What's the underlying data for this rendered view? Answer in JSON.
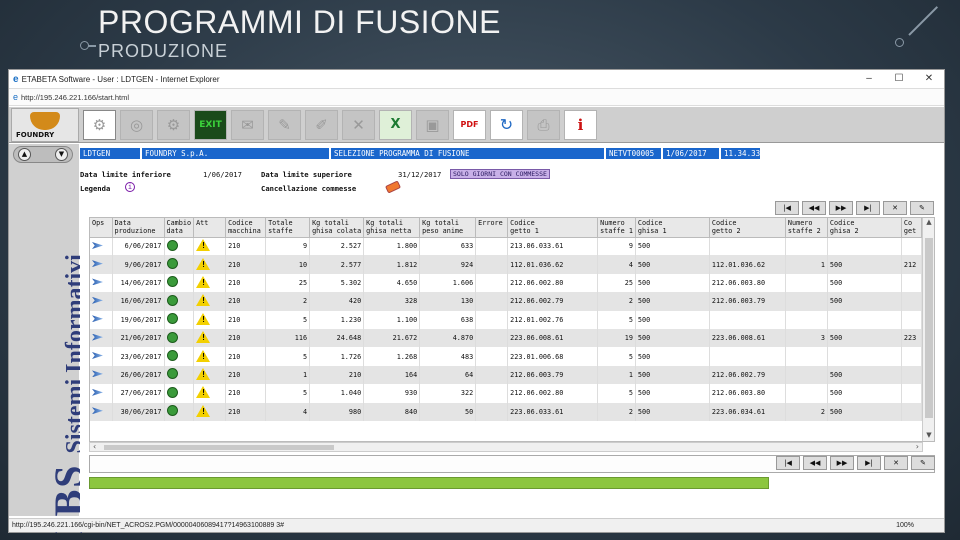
{
  "slide": {
    "title": "PROGRAMMI DI FUSIONE",
    "subtitle": "PRODUZIONE"
  },
  "window": {
    "title": "ETABETA Software - User : LDTGEN - Internet Explorer",
    "address": "http://195.246.221.166/start.html",
    "controls": [
      "–",
      "☐",
      "✕"
    ],
    "status_url": "http://195.246.221.166/cgi-bin/NET_ACROS2.PGM/00000406089417?14963100889 3#",
    "zoom": "100%"
  },
  "toolbar": {
    "logo_text": "FOUNDRY",
    "buttons": [
      "tool-1",
      "disc",
      "gear",
      "exit",
      "export",
      "edit",
      "tool-7",
      "cancel",
      "excel",
      "box",
      "pdf",
      "refresh",
      "print",
      "info"
    ],
    "exit_label": "EXIT",
    "pdf_label": "PDF",
    "excel_label": "X",
    "info_label": "i"
  },
  "sidebar": {
    "brand_big": "IBS",
    "brand_small": "Sistemi Informativi",
    "prev_arrow": "▲",
    "next_arrow": "▼"
  },
  "info_bar": {
    "user": "LDTGEN",
    "company": "FOUNDRY S.p.A.",
    "screen": "SELEZIONE PROGRAMMA DI FUSIONE",
    "terminal": "NETVT00005",
    "date": "1/06/2017",
    "time": "11.34.33"
  },
  "filters": {
    "lower_label": "Data limite inferiore",
    "lower_value": "1/06/2017",
    "upper_label": "Data limite superiore",
    "upper_value": "31/12/2017",
    "only_orders_button": "SOLO GIORNI CON COMMESSE",
    "legend_label": "Legenda",
    "legend_icon": "i",
    "cancel_orders_label": "Cancellazione commesse"
  },
  "pager": [
    "|◀",
    "◀◀",
    "▶▶",
    "▶|",
    "✕",
    "✎"
  ],
  "grid": {
    "headers": [
      [
        "Ops",
        ""
      ],
      [
        "Data",
        "produzione"
      ],
      [
        "Cambio",
        "data"
      ],
      [
        "Att",
        ""
      ],
      [
        "Codice",
        "macchina"
      ],
      [
        "Totale",
        "staffe"
      ],
      [
        "Kg totali",
        "ghisa colata"
      ],
      [
        "Kg totali",
        "ghisa netta"
      ],
      [
        "Kg totali",
        "peso anime"
      ],
      [
        "Errore",
        ""
      ],
      [
        "Codice",
        "getto  1"
      ],
      [
        "Numero",
        "staffe  1"
      ],
      [
        "Codice",
        "ghisa  1"
      ],
      [
        "Codice",
        "getto  2"
      ],
      [
        "Numero",
        "staffe  2"
      ],
      [
        "Codice",
        "ghisa  2"
      ],
      [
        "Co",
        "get"
      ]
    ],
    "rows": [
      [
        "6/06/2017",
        "210",
        "9",
        "2.527",
        "1.800",
        "633",
        "",
        "213.06.033.61",
        "9",
        "500",
        "",
        "",
        "",
        ""
      ],
      [
        "9/06/2017",
        "210",
        "10",
        "2.577",
        "1.812",
        "924",
        "",
        "112.01.036.62",
        "4",
        "500",
        "112.01.036.62",
        "1",
        "500",
        "212"
      ],
      [
        "14/06/2017",
        "210",
        "25",
        "5.302",
        "4.650",
        "1.606",
        "",
        "212.06.002.80",
        "25",
        "500",
        "212.06.003.80",
        "",
        "500",
        ""
      ],
      [
        "16/06/2017",
        "210",
        "2",
        "420",
        "328",
        "130",
        "",
        "212.06.002.79",
        "2",
        "500",
        "212.06.003.79",
        "",
        "500",
        ""
      ],
      [
        "19/06/2017",
        "210",
        "5",
        "1.230",
        "1.100",
        "638",
        "",
        "212.01.002.76",
        "5",
        "500",
        "",
        "",
        "",
        ""
      ],
      [
        "21/06/2017",
        "210",
        "116",
        "24.648",
        "21.672",
        "4.870",
        "",
        "223.06.008.61",
        "19",
        "500",
        "223.06.008.61",
        "3",
        "500",
        "223"
      ],
      [
        "23/06/2017",
        "210",
        "5",
        "1.726",
        "1.268",
        "483",
        "",
        "223.01.006.68",
        "5",
        "500",
        "",
        "",
        "",
        ""
      ],
      [
        "26/06/2017",
        "210",
        "1",
        "210",
        "164",
        "64",
        "",
        "212.06.003.79",
        "1",
        "500",
        "212.06.002.79",
        "",
        "500",
        ""
      ],
      [
        "27/06/2017",
        "210",
        "5",
        "1.040",
        "930",
        "322",
        "",
        "212.06.002.80",
        "5",
        "500",
        "212.06.003.80",
        "",
        "500",
        ""
      ],
      [
        "30/06/2017",
        "210",
        "4",
        "980",
        "840",
        "50",
        "",
        "223.06.033.61",
        "2",
        "500",
        "223.06.034.61",
        "2",
        "500",
        ""
      ]
    ]
  },
  "colors": {
    "accent_blue": "#1a66cc",
    "progress_green": "#8cc63f",
    "brand_navy": "#2f3d7a"
  }
}
